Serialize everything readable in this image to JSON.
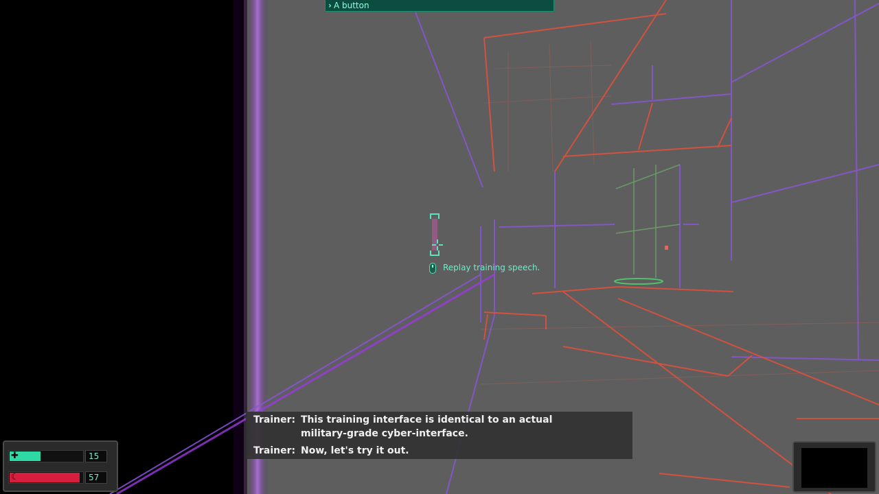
{
  "objective": {
    "text": "A button"
  },
  "interaction_hint": {
    "icon": "mouse-icon",
    "text": "Replay training speech."
  },
  "dialogue": [
    {
      "speaker": "Trainer:",
      "lines": [
        "This training interface is identical to an actual",
        "military-grade cyber-interface."
      ]
    },
    {
      "speaker": "Trainer:",
      "lines": [
        "Now, let's try it out."
      ]
    }
  ],
  "hud": {
    "health": {
      "icon": "plus-icon",
      "value": "15",
      "fill_percent": 42,
      "color": "#2fd9a6"
    },
    "energy": {
      "icon": "crescent-icon",
      "value": "57",
      "fill_percent": 96,
      "color": "#d81e3e"
    }
  },
  "colors": {
    "grid_red": "#e0503c",
    "grid_purple": "#8a4ad8",
    "grid_green": "#6fa86f",
    "floor": "#5a5a5a",
    "accent": "#5fffc8"
  }
}
